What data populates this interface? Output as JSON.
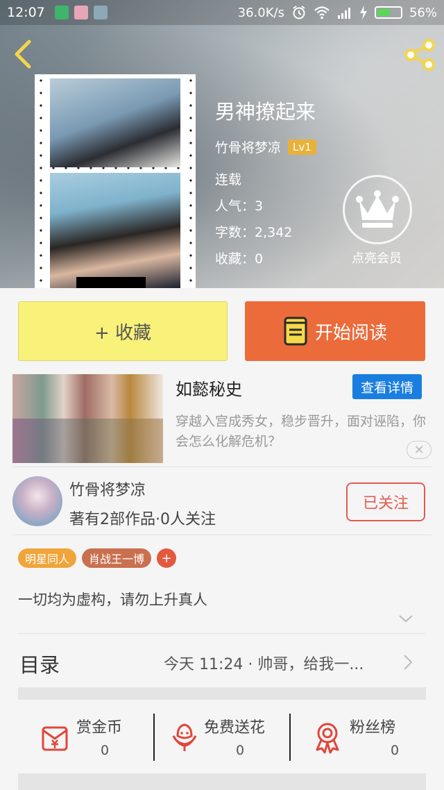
{
  "status_bar": {
    "time": "12:07",
    "network_speed": "36.0K/s",
    "battery_percent": "56%",
    "battery_level": 0.56
  },
  "colors": {
    "collect_bg": "#f9f27a",
    "read_bg": "#ec6b3a",
    "detail_btn_bg": "#1a7ee0",
    "follow_border": "#e35a4e",
    "tag_1": "#f0a43a",
    "tag_2": "#c9704f",
    "tag_add": "#e3583f",
    "level_badge": "#e8b13a"
  },
  "icons": {
    "back": "chevron-left-icon",
    "share": "share-icon",
    "vip": "crown-icon",
    "book": "book-icon",
    "reward": "red-envelope-icon",
    "flower": "flower-icon",
    "fans": "medal-icon"
  },
  "book": {
    "title": "男神撩起来",
    "author": "竹骨将梦凉",
    "level": "Lv1",
    "status": "连载",
    "popularity": "人气：3",
    "word_count": "字数：2,342",
    "favorites": "收藏：0",
    "vip_label": "点亮会员"
  },
  "actions": {
    "collect_label": "+ 收藏",
    "read_label": "开始阅读"
  },
  "ad": {
    "title": "如懿秘史",
    "detail_label": "查看详情",
    "description": "穿越入宫成秀女，稳步晋升，面对诬陷，你会怎么化解危机？",
    "close_glyph": "✕"
  },
  "author_card": {
    "name": "竹骨将梦凉",
    "stats": "著有2部作品·0人关注",
    "follow_label": "已关注"
  },
  "tags": {
    "items": [
      "明星同人",
      "肖战王一博"
    ],
    "add_label": "+"
  },
  "summary": "一切均为虚构，请勿上升真人",
  "catalog": {
    "label": "目录",
    "latest": "今天 11:24 · 帅哥，给我一..."
  },
  "bottom_stats": [
    {
      "label": "赏金币",
      "value": "0"
    },
    {
      "label": "免费送花",
      "value": "0"
    },
    {
      "label": "粉丝榜",
      "value": "0"
    }
  ]
}
